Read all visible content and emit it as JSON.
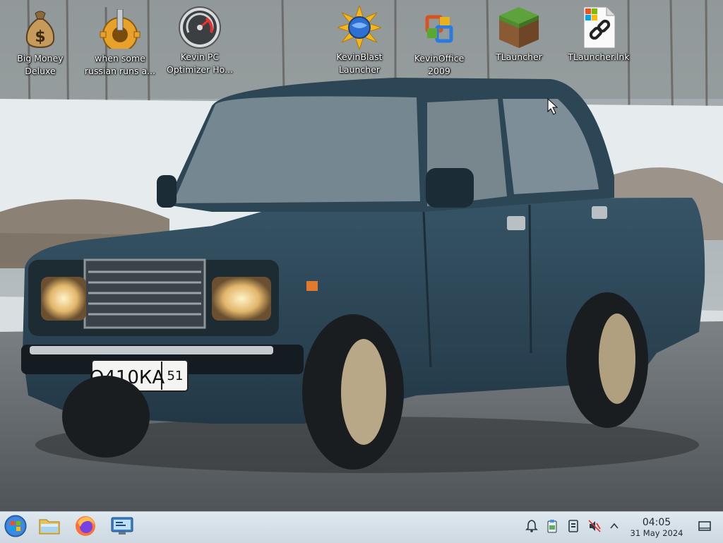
{
  "desktop": {
    "icons": [
      {
        "label": "Big Money\nDeluxe",
        "icon": "money-bag-icon"
      },
      {
        "label": "when some\nrussian runs a...",
        "icon": "gear-icon"
      },
      {
        "label": "Kevin PC\nOptimizer Ho...",
        "icon": "speedometer-icon"
      },
      {
        "label": "KevinBlast\nLauncher",
        "icon": "sunburst-globe-icon"
      },
      {
        "label": "KevinOffice\n2009",
        "icon": "office-logo-icon"
      },
      {
        "label": "TLauncher",
        "icon": "grass-block-icon"
      },
      {
        "label": "TLauncher.lnk",
        "icon": "shortcut-file-icon"
      }
    ],
    "wallpaper": {
      "description_colors": {
        "car": "#2c4656",
        "road": "#5b6166",
        "snow": "#e7ecef"
      },
      "plate_text": "О410КА",
      "plate_region": "51"
    }
  },
  "taskbar": {
    "start": {
      "icon": "start-orb-icon"
    },
    "pinned": [
      {
        "icon": "file-manager-folder-icon"
      },
      {
        "icon": "firefox-icon"
      },
      {
        "icon": "system-settings-icon"
      }
    ],
    "tray": [
      {
        "icon": "notification-bell-icon"
      },
      {
        "icon": "clipboard-icon"
      },
      {
        "icon": "removable-device-icon"
      },
      {
        "icon": "volume-muted-icon"
      },
      {
        "icon": "chevron-up-icon"
      }
    ],
    "clock": {
      "time": "04:05",
      "date": "31 May 2024"
    },
    "show_desktop": {
      "icon": "show-desktop-icon"
    }
  }
}
